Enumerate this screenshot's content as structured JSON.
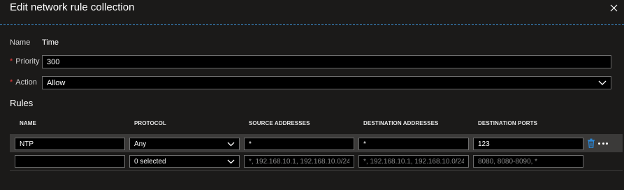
{
  "blade": {
    "title": "Edit network rule collection",
    "close_icon": "close-icon",
    "accent_color": "#3a8fd1"
  },
  "form": {
    "required_marker": "*",
    "name_label": "Name",
    "name_value": "Time",
    "priority_label": "Priority",
    "priority_value": "300",
    "action_label": "Action",
    "action_value": "Allow"
  },
  "rules": {
    "section_title": "Rules",
    "columns": [
      "NAME",
      "PROTOCOL",
      "SOURCE ADDRESSES",
      "DESTINATION ADDRESSES",
      "DESTINATION PORTS"
    ],
    "row": {
      "name": "NTP",
      "protocol": "Any",
      "source_addresses": "*",
      "destination_addresses": "*",
      "destination_ports": "123",
      "delete_icon": "trash-icon",
      "more_icon": "more-icon"
    },
    "new_row": {
      "name": "",
      "protocol": "0 selected",
      "source_placeholder": "*, 192.168.10.1, 192.168.10.0/24,...",
      "destination_placeholder": "*, 192.168.10.1, 192.168.10.0/24,...",
      "ports_placeholder": "8080, 8080-8090, *"
    }
  }
}
